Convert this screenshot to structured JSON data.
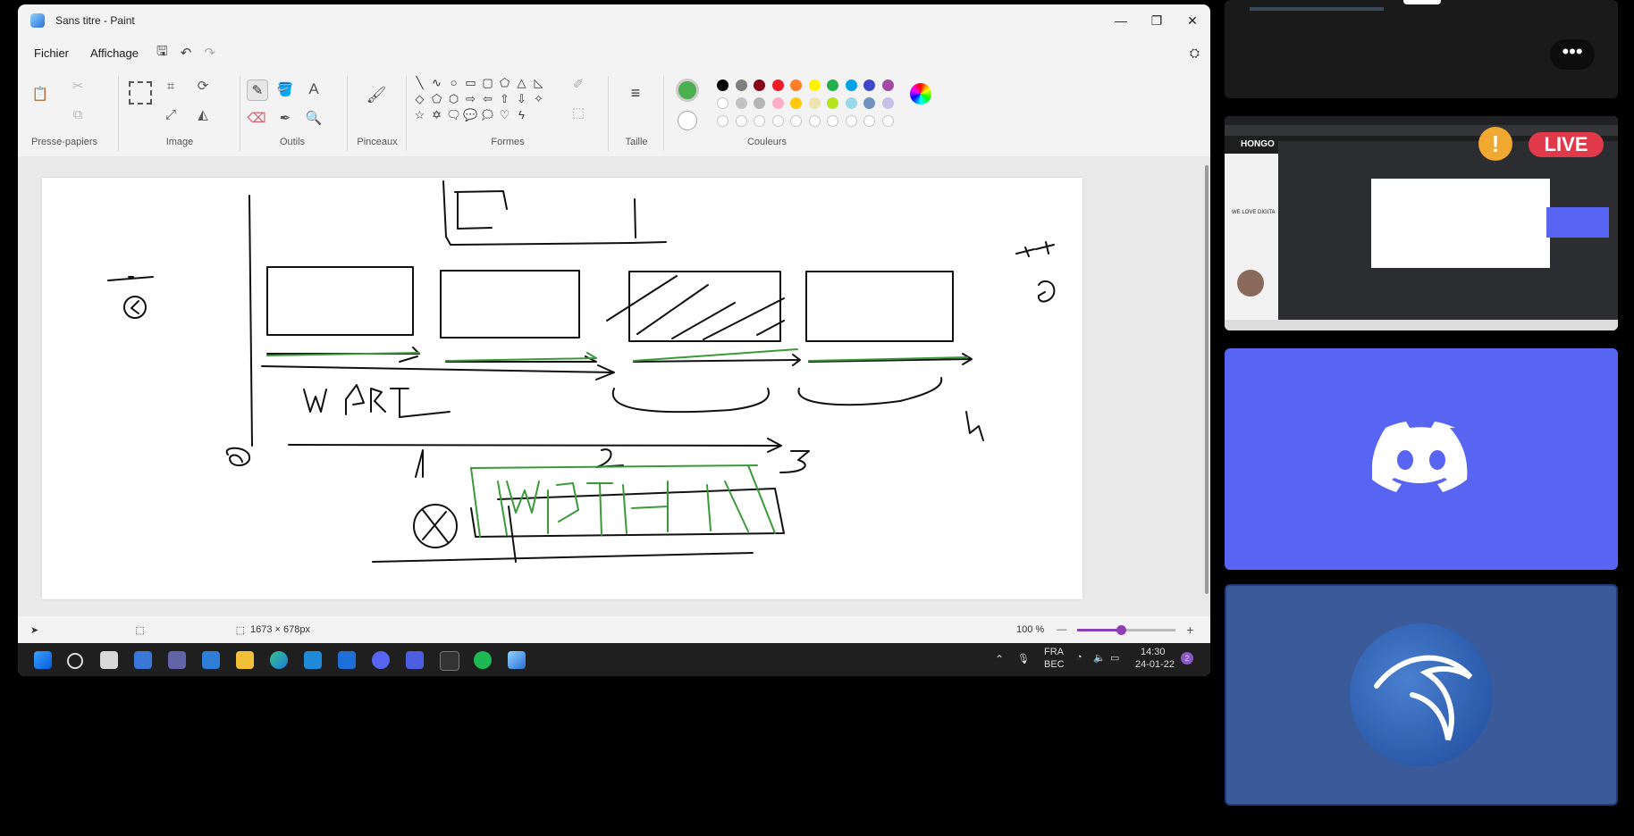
{
  "window": {
    "title": "Sans titre - Paint",
    "minimize": "—",
    "restore": "❐",
    "close": "✕"
  },
  "menu": {
    "file": "Fichier",
    "view": "Affichage"
  },
  "ribbon": {
    "groups": {
      "clipboard": "Presse-papiers",
      "image": "Image",
      "tools": "Outils",
      "brushes": "Pinceaux",
      "shapes": "Formes",
      "size": "Taille",
      "colors": "Couleurs"
    }
  },
  "colors": {
    "primary": "#4caf50",
    "secondary": "#ffffff",
    "palette_row1": [
      "#000000",
      "#7f7f7f",
      "#880015",
      "#ed1c24",
      "#ff7f27",
      "#fff200",
      "#22b14c",
      "#00a2e8",
      "#3f48cc",
      "#a349a4"
    ],
    "palette_row2": [
      "#ffffff",
      "#c3c3c3",
      "#b5b5b5",
      "#ffaec9",
      "#ffc90e",
      "#efe4b0",
      "#b5e61d",
      "#99d9ea",
      "#7092be",
      "#c8bfe7"
    ]
  },
  "status": {
    "dimensions": "1673 × 678px",
    "zoom": "100 %"
  },
  "taskbar": {
    "lang_top": "FRA",
    "lang_bottom": "BEC",
    "time": "14:30",
    "date": "24-01-22",
    "badge": "2"
  },
  "side": {
    "live_label": "LIVE",
    "brand": "HONGO",
    "headline": "WE LOVE DIGITA"
  }
}
